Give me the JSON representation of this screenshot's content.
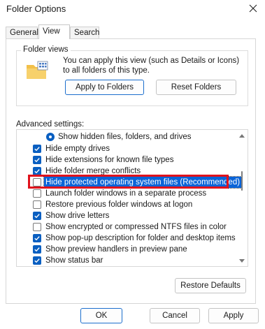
{
  "window": {
    "title": "Folder Options"
  },
  "tabs": [
    {
      "label": "General"
    },
    {
      "label": "View"
    },
    {
      "label": "Search"
    }
  ],
  "folder_views": {
    "label": "Folder views",
    "description": "You can apply this view (such as Details or Icons) to all folders of this type.",
    "apply_button": "Apply to Folders",
    "reset_button": "Reset Folders"
  },
  "advanced": {
    "label": "Advanced settings:",
    "items": [
      {
        "kind": "radio",
        "label": "Show hidden files, folders, and drives",
        "checked": true
      },
      {
        "kind": "checkbox",
        "label": "Hide empty drives",
        "checked": true
      },
      {
        "kind": "checkbox",
        "label": "Hide extensions for known file types",
        "checked": true
      },
      {
        "kind": "checkbox",
        "label": "Hide folder merge conflicts",
        "checked": true
      },
      {
        "kind": "checkbox",
        "label": "Hide protected operating system files (Recommended)",
        "checked": false,
        "selected": true
      },
      {
        "kind": "checkbox",
        "label": "Launch folder windows in a separate process",
        "checked": false
      },
      {
        "kind": "checkbox",
        "label": "Restore previous folder windows at logon",
        "checked": false
      },
      {
        "kind": "checkbox",
        "label": "Show drive letters",
        "checked": true
      },
      {
        "kind": "checkbox",
        "label": "Show encrypted or compressed NTFS files in color",
        "checked": false
      },
      {
        "kind": "checkbox",
        "label": "Show pop-up description for folder and desktop items",
        "checked": true
      },
      {
        "kind": "checkbox",
        "label": "Show preview handlers in preview pane",
        "checked": true
      },
      {
        "kind": "checkbox",
        "label": "Show status bar",
        "checked": true
      }
    ],
    "restore_defaults": "Restore Defaults"
  },
  "footer": {
    "ok": "OK",
    "cancel": "Cancel",
    "apply": "Apply"
  },
  "colors": {
    "accent": "#0a5fc1",
    "highlight_border": "#e0121c"
  }
}
